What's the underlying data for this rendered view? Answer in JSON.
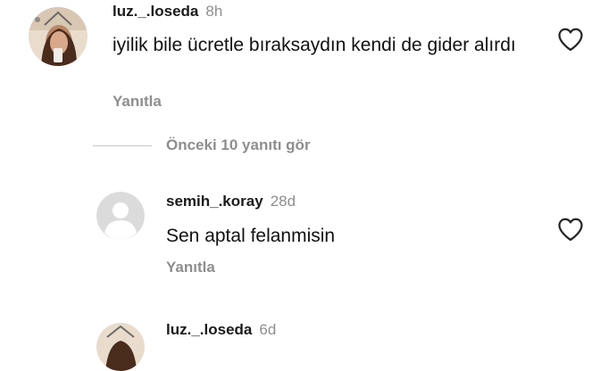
{
  "comments": [
    {
      "username": "luz._.loseda",
      "time": "8h",
      "text": "iyilik bile ücretle bıraksaydın kendi de gider alırdı",
      "reply_label": "Yanıtla"
    },
    {
      "username": "semih_.koray",
      "time": "28d",
      "text": "Sen aptal felanmisin",
      "reply_label": "Yanıtla"
    },
    {
      "username": "luz._.loseda",
      "time": "6d"
    }
  ],
  "view_previous_replies": "Önceki 10 yanıtı gör",
  "icons": {
    "like": "heart-outline-icon",
    "default_avatar": "default-avatar-icon"
  },
  "colors": {
    "text": "#111111",
    "muted": "#8e8e8e",
    "divider": "#c7c7c7"
  }
}
